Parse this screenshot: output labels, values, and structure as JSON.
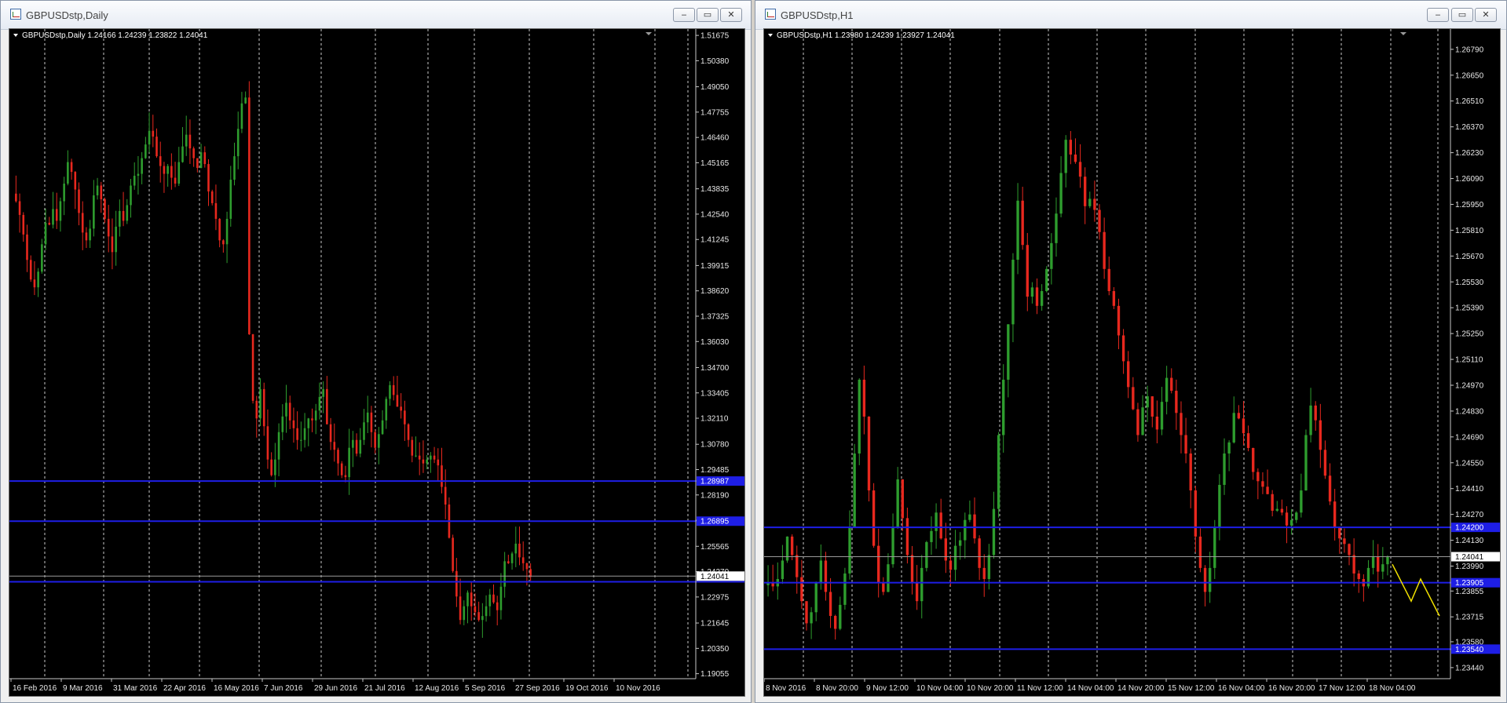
{
  "windows": [
    {
      "id": "w1",
      "title": "GBPUSDstp,Daily",
      "header": "GBPUSDstp,Daily  1.24166 1.24239 1.23822 1.24041",
      "controls": {
        "minimize": "‒",
        "restore": "▭",
        "close": "✕"
      },
      "chart_data": {
        "type": "candlestick",
        "ylim": [
          1.188,
          1.52
        ],
        "y_ticks": [
          1.51675,
          1.5038,
          1.4905,
          1.47755,
          1.4646,
          1.45165,
          1.43835,
          1.4254,
          1.41245,
          1.39915,
          1.3862,
          1.37325,
          1.3603,
          1.347,
          1.33405,
          1.3211,
          1.3078,
          1.29485,
          1.2819,
          1.26895,
          1.25565,
          1.2427,
          1.22975,
          1.21645,
          1.2035,
          1.19055
        ],
        "x_labels": [
          "16 Feb 2016",
          "9 Mar 2016",
          "31 Mar 2016",
          "22 Apr 2016",
          "16 May 2016",
          "7 Jun 2016",
          "29 Jun 2016",
          "21 Jul 2016",
          "12 Aug 2016",
          "5 Sep 2016",
          "27 Sep 2016",
          "19 Oct 2016",
          "10 Nov 2016"
        ],
        "levels": [
          1.289,
          1.2685,
          1.2375
        ],
        "current_price": "1.24041",
        "price_label_blue_1": "1.28987",
        "price_label_blue_2": "1.26895",
        "closes": [
          1.432,
          1.425,
          1.415,
          1.402,
          1.392,
          1.388,
          1.396,
          1.41,
          1.421,
          1.42,
          1.428,
          1.422,
          1.432,
          1.441,
          1.452,
          1.447,
          1.438,
          1.426,
          1.416,
          1.412,
          1.418,
          1.435,
          1.44,
          1.433,
          1.423,
          1.414,
          1.406,
          1.419,
          1.427,
          1.422,
          1.43,
          1.44,
          1.445,
          1.446,
          1.454,
          1.461,
          1.468,
          1.465,
          1.455,
          1.45,
          1.446,
          1.45,
          1.444,
          1.441,
          1.452,
          1.46,
          1.466,
          1.459,
          1.454,
          1.449,
          1.457,
          1.451,
          1.437,
          1.431,
          1.423,
          1.412,
          1.41,
          1.423,
          1.443,
          1.455,
          1.469,
          1.482,
          1.485,
          1.364,
          1.33,
          1.321,
          1.336,
          1.317,
          1.3,
          1.292,
          1.3,
          1.314,
          1.322,
          1.329,
          1.32,
          1.316,
          1.31,
          1.31,
          1.316,
          1.321,
          1.32,
          1.325,
          1.332,
          1.336,
          1.318,
          1.309,
          1.305,
          1.298,
          1.292,
          1.291,
          1.306,
          1.31,
          1.303,
          1.31,
          1.319,
          1.324,
          1.314,
          1.306,
          1.313,
          1.32,
          1.331,
          1.338,
          1.333,
          1.327,
          1.325,
          1.318,
          1.31,
          1.302,
          1.302,
          1.3,
          1.298,
          1.3,
          1.302,
          1.3,
          1.297,
          1.286,
          1.277,
          1.26,
          1.243,
          1.23,
          1.218,
          1.225,
          1.232,
          1.225,
          1.222,
          1.218,
          1.22,
          1.225,
          1.231,
          1.227,
          1.223,
          1.235,
          1.248,
          1.247,
          1.252,
          1.257,
          1.25,
          1.247,
          1.244,
          1.24
        ]
      }
    },
    {
      "id": "w2",
      "title": "GBPUSDstp,H1",
      "header": "GBPUSDstp,H1  1.23980 1.24239 1.23927 1.24041",
      "controls": {
        "minimize": "‒",
        "restore": "▭",
        "close": "✕"
      },
      "chart_data": {
        "type": "candlestick",
        "ylim": [
          1.2338,
          1.269
        ],
        "y_ticks": [
          1.2679,
          1.2665,
          1.2651,
          1.2637,
          1.2623,
          1.2609,
          1.2595,
          1.2581,
          1.2567,
          1.2553,
          1.2539,
          1.2525,
          1.2511,
          1.2497,
          1.2483,
          1.2469,
          1.2455,
          1.2441,
          1.2427,
          1.2413,
          1.2399,
          1.23855,
          1.23715,
          1.2358,
          1.2344
        ],
        "x_labels": [
          "8 Nov 2016",
          "8 Nov 20:00",
          "9 Nov 12:00",
          "10 Nov 04:00",
          "10 Nov 20:00",
          "11 Nov 12:00",
          "14 Nov 04:00",
          "14 Nov 20:00",
          "15 Nov 12:00",
          "16 Nov 04:00",
          "16 Nov 20:00",
          "17 Nov 12:00",
          "18 Nov 04:00"
        ],
        "levels": [
          1.242,
          1.239,
          1.2354
        ],
        "current_price": "1.24041",
        "price_label_blue_1": "1.24200",
        "price_label_blue_2": "1.23905",
        "price_label_blue_3": "1.23540",
        "projection": [
          1.24,
          1.239,
          1.238,
          1.2392,
          1.2382,
          1.2372
        ],
        "closes": [
          1.239,
          1.2388,
          1.2392,
          1.2402,
          1.2415,
          1.2405,
          1.2393,
          1.238,
          1.2368,
          1.2374,
          1.239,
          1.2402,
          1.2385,
          1.2372,
          1.2365,
          1.2378,
          1.2395,
          1.242,
          1.246,
          1.25,
          1.248,
          1.244,
          1.241,
          1.239,
          1.2385,
          1.24,
          1.242,
          1.2446,
          1.2425,
          1.2405,
          1.239,
          1.238,
          1.2398,
          1.2412,
          1.2418,
          1.2428,
          1.2414,
          1.2402,
          1.2397,
          1.241,
          1.2413,
          1.2424,
          1.2427,
          1.2414,
          1.2398,
          1.2392,
          1.2405,
          1.243,
          1.247,
          1.25,
          1.253,
          1.2565,
          1.2597,
          1.2573,
          1.2545,
          1.255,
          1.254,
          1.2548,
          1.256,
          1.2574,
          1.259,
          1.2612,
          1.263,
          1.2622,
          1.2618,
          1.261,
          1.2594,
          1.2598,
          1.2592,
          1.258,
          1.256,
          1.2548,
          1.254,
          1.2524,
          1.251,
          1.2496,
          1.2484,
          1.247,
          1.2485,
          1.2491,
          1.248,
          1.2473,
          1.2488,
          1.2501,
          1.2494,
          1.2482,
          1.247,
          1.246,
          1.244,
          1.2415,
          1.2398,
          1.2385,
          1.2398,
          1.242,
          1.2443,
          1.246,
          1.2466,
          1.2482,
          1.2479,
          1.2471,
          1.2463,
          1.245,
          1.2445,
          1.2442,
          1.2438,
          1.2429,
          1.243,
          1.2428,
          1.2421,
          1.2424,
          1.2428,
          1.244,
          1.247,
          1.2486,
          1.2478,
          1.2462,
          1.2448,
          1.2434,
          1.242,
          1.2414,
          1.2411,
          1.2405,
          1.2395,
          1.2392,
          1.2388,
          1.2398,
          1.2404,
          1.2396,
          1.24,
          1.2404
        ]
      }
    }
  ]
}
